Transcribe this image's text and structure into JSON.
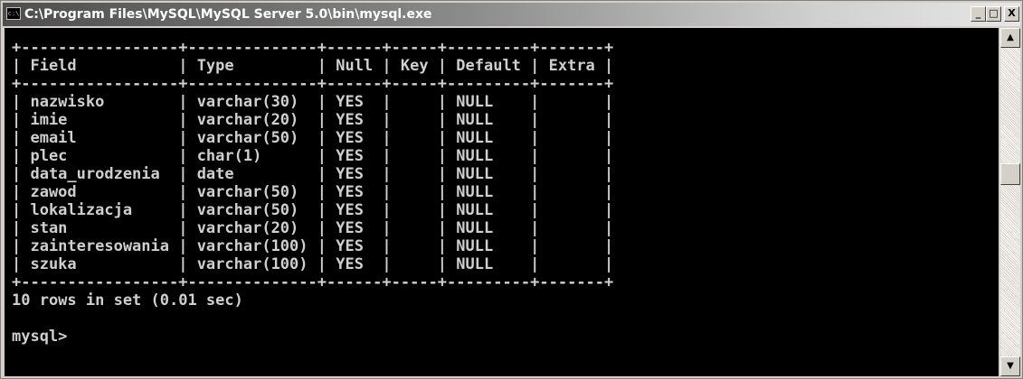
{
  "window": {
    "title": "C:\\Program Files\\MySQL\\MySQL Server 5.0\\bin\\mysql.exe",
    "icon": "cmd-icon",
    "icon_text": "c:\\",
    "buttons": {
      "minimize": "_",
      "maximize": "□",
      "close": "X"
    }
  },
  "console": {
    "text": "+-----------------+--------------+------+-----+---------+-------+\n| Field           | Type         | Null | Key | Default | Extra |\n+-----------------+--------------+------+-----+---------+-------+\n| nazwisko        | varchar(30)  | YES  |     | NULL    |       |\n| imie            | varchar(20)  | YES  |     | NULL    |       |\n| email           | varchar(50)  | YES  |     | NULL    |       |\n| plec            | char(1)      | YES  |     | NULL    |       |\n| data_urodzenia  | date         | YES  |     | NULL    |       |\n| zawod           | varchar(50)  | YES  |     | NULL    |       |\n| lokalizacja     | varchar(50)  | YES  |     | NULL    |       |\n| stan            | varchar(20)  | YES  |     | NULL    |       |\n| zainteresowania | varchar(100) | YES  |     | NULL    |       |\n| szuka           | varchar(100) | YES  |     | NULL    |       |\n+-----------------+--------------+------+-----+---------+-------+\n10 rows in set (0.01 sec)\n\nmysql>"
  },
  "scrollbar": {
    "up": "▲",
    "down": "▼"
  },
  "colors": {
    "console_bg": "#000000",
    "console_text": "#cfcfcf",
    "chrome": "#d4d0c8"
  }
}
